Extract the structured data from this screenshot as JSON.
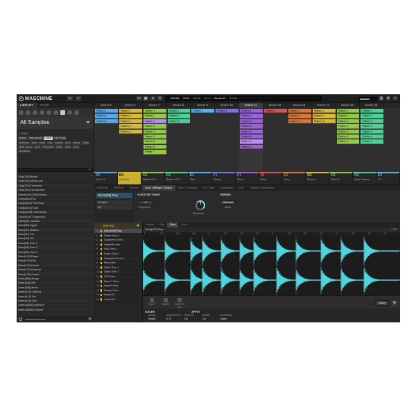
{
  "app": {
    "name": "MASCHINE"
  },
  "titlebar": {
    "tempo": "125.00",
    "tempo_unit": "BPM",
    "swing": "0.0 %",
    "signature": "4 / 4",
    "scene": "Scene 11",
    "position": "1 / 16"
  },
  "browser": {
    "tabs": [
      "LIBRARY",
      "FILES"
    ],
    "category": "All Samples",
    "types_label": "TYPES",
    "type_chips": [
      "Drums",
      "Instruments",
      "Loops",
      "One Shots"
    ],
    "sub_chips": [
      "Ambience",
      "Bass",
      "Brass",
      "Clap",
      "Cymbal",
      "Drum",
      "Drums",
      "Guitar",
      "Hihat Closed",
      "Keys",
      "Percussion",
      "Snare",
      "Synth",
      "Vocal",
      "Woodwind"
    ],
    "files": [
      "Clap[126] Biplan",
      "Clap[128] Melbourne",
      "Clap[129] Teomonie",
      "Clap[130] Youngblown",
      "Openhhnd[126] Entropy",
      "Conga[84] Pux",
      "Conga[110] Feleriosa",
      "Conga[110] Gaia",
      "Conga[128] Chlorophyll",
      "Crash[140] TrappedUp",
      "Dairo[86] Caravan",
      "Dairo[88] Egypt",
      "Dairo[90] Mataco",
      "Dairo[90] Pet",
      "Dairo[96] Rio",
      "Dairo[96] Raw 1",
      "Dairo[96] Raw 2",
      "Dairo[96] Raw 3",
      "Dairo[100] Rajan",
      "Dairo[100] Rak",
      "Dairo[104] Camel",
      "Dairo[110] Kalahari",
      "Dairo[120] Camel",
      "Darbu[86] Mirage",
      "Darbu[90] Nile",
      "Darbu[98] Merrin",
      "Darbu[104] Sahrna",
      "Darbu[110] Rio",
      "Darbu[118] Zen",
      "Darbuka[90] Elephant",
      "Darbuka[95] Folklore"
    ]
  },
  "arranger": {
    "scenes": [
      "Scene 5",
      "Scene 6",
      "Scene 7",
      "Scene 8",
      "Scene 9",
      "Scene 10",
      "Scene 11",
      "Scene 12",
      "Scene 13",
      "Scene 14",
      "Scene 15",
      "Scene 16"
    ],
    "current_scene_index": 6,
    "columns": [
      {
        "color": "#5da7e6",
        "patterns": [
          "Pattern 1",
          "Pattern 4",
          "Pattern 4"
        ]
      },
      {
        "color": "#d6b83c",
        "patterns": [
          "Pattern 1",
          "Pattern 2",
          "Pattern 2",
          "Pattern 3",
          "Pattern 3"
        ]
      },
      {
        "color": "#93c94b",
        "patterns": [
          "Pattern 1",
          "Pattern 2",
          "Pattern 4",
          "Pattern 5",
          "Pattern 2",
          "Pattern 3",
          "Pattern 6",
          "Pattern 8",
          "Pattern 7"
        ]
      },
      {
        "color": "#4fcf96",
        "patterns": [
          "Pattern 1",
          "Pattern 2",
          "Pattern 3"
        ]
      },
      {
        "color": "#58b3e8",
        "patterns": [
          "Pattern 1"
        ]
      },
      {
        "color": "#7c72e3",
        "patterns": [
          "Pattern 1"
        ]
      },
      {
        "color": "#9b63d8",
        "patterns": [
          "Pattern 1",
          "Pattern 2",
          "Pattern 3",
          "Pattern 4",
          "Pattern 5",
          "Pattern 6",
          "Pattern 7",
          "Pattern 8"
        ]
      },
      {
        "color": "#d85454",
        "patterns": [
          "Pattern 1"
        ]
      },
      {
        "color": "#d2793f",
        "patterns": [
          "Pattern 1",
          "Pattern 2",
          "Pattern 3"
        ]
      },
      {
        "color": "#d6b83c",
        "patterns": [
          "Pattern 1",
          "Pattern 2",
          "Pattern 3"
        ]
      },
      {
        "color": "#93c94b",
        "patterns": [
          "Pattern 1",
          "Pattern 2",
          "Pattern 3",
          "Pattern 4",
          "Pattern 5",
          "Pattern 6",
          "Pattern 7"
        ]
      },
      {
        "color": "#4fcf96",
        "patterns": [
          "Pattern 1",
          "Pattern 2",
          "Pattern 3",
          "Pattern 4",
          "Pattern 5",
          "Pattern 6",
          "Pattern 7"
        ]
      }
    ],
    "groups": [
      {
        "id": "A1",
        "name": "Gem Kit",
        "color": "#5da7e6"
      },
      {
        "id": "B1",
        "name": "Gem Kit",
        "color": "#d6b83c"
      },
      {
        "id": "C1",
        "name": "Blatter Kit 2",
        "color": "#93c94b"
      },
      {
        "id": "D1",
        "name": "Blatter Kit 2",
        "color": "#4fcf96"
      },
      {
        "id": "E1",
        "name": "Wire",
        "color": "#58b3e8"
      },
      {
        "id": "F1",
        "name": "Stomp",
        "color": "#7c72e3"
      },
      {
        "id": "G1",
        "name": "Shout",
        "color": "#9b63d8"
      },
      {
        "id": "H1",
        "name": "Blow",
        "color": "#d85454"
      },
      {
        "id": "A2",
        "name": "Gem",
        "color": "#d2793f"
      },
      {
        "id": "B2",
        "name": "Exec 1",
        "color": "#d6b83c"
      },
      {
        "id": "C2",
        "name": "Drum 2",
        "color": "#93c94b"
      },
      {
        "id": "D2",
        "name": "Amb Horizon",
        "color": "#4fcf96"
      },
      {
        "id": "E2",
        "name": "Pr...",
        "color": "#58b3e8"
      }
    ],
    "selected_group_index": 1
  },
  "controls": {
    "tabs": [
      "MASTER",
      "GROUP",
      "SOUND",
      "Voice Settings / Engine",
      "Pitch / Envelope",
      "FX / Filter",
      "Modulation",
      "LFO",
      "Velocity / Modwheel"
    ],
    "active_tab_index": 3,
    "slot": {
      "name": "Dairo[100] Raw",
      "plugin": "Sampler",
      "eq": "EQ"
    },
    "voice_settings_label": "VOICE SETTINGS",
    "polyphony_label": "Polyphony",
    "polyphony_value": "8",
    "pitchbend_label": "Pitchbend",
    "engine_label": "ENGINE",
    "mode_label": "Mode",
    "mode_value": "Standard"
  },
  "pads": {
    "kit_name": "Gem Kit",
    "items": [
      {
        "n": "1",
        "name": "Dairo[100] Raw",
        "color": "#d6b83c"
      },
      {
        "n": "2",
        "name": "Snare Gem 1",
        "color": "#d6b83c"
      },
      {
        "n": "3",
        "name": "ClosedHH Gem 1",
        "color": "#d6b83c"
      },
      {
        "n": "4",
        "name": "OpenHH Gem",
        "color": "#d6b83c"
      },
      {
        "n": "5",
        "name": "Kick Gem 2",
        "color": "#d6b83c"
      },
      {
        "n": "6",
        "name": "Snare Gem 4",
        "color": "#d6b83c"
      },
      {
        "n": "7",
        "name": "ClosedHH Gem 2",
        "color": "#d6b83c"
      },
      {
        "n": "8",
        "name": "Perc Gem",
        "color": "#d6b83c"
      },
      {
        "n": "9",
        "name": "Glitch Gem 1",
        "color": "#d6b83c"
      },
      {
        "n": "10",
        "name": "Glitch Gem 2",
        "color": "#d6b83c"
      },
      {
        "n": "11",
        "name": "SFX Gem",
        "color": "#d6b83c"
      },
      {
        "n": "12",
        "name": "Bass C Gem",
        "color": "#d6b83c"
      },
      {
        "n": "13",
        "name": "Impact Gem",
        "color": "#d6b83c"
      },
      {
        "n": "14",
        "name": "Sweep Gem",
        "color": "#d6b83c"
      },
      {
        "n": "15",
        "name": "Sound 15",
        "color": "#d6b83c"
      },
      {
        "n": "16",
        "name": "Sound 16",
        "color": "#d6b83c"
      }
    ],
    "selected_index": 0
  },
  "editor": {
    "tabs": [
      "Record",
      "Edit",
      "Slice",
      "Zone"
    ],
    "active_tab_index": 2,
    "sample_name": "Dairo[100] Raw",
    "zoom": "4.00x",
    "ruler": [
      "1",
      "1.2",
      "1.3",
      "1.4",
      "2",
      "2.2",
      "2.3",
      "2.4",
      "3",
      "3.2",
      "3.3",
      "3.4",
      "4",
      "4.2",
      "4.3",
      "4.4"
    ],
    "wave_color": "#4fd3dc",
    "tools": [
      "SLICE",
      "SHARE",
      "DELETE ALL"
    ],
    "apply_label": "Apply",
    "slicer": {
      "label": "SLICER",
      "apply_label": "APPLY",
      "params": [
        {
          "label": "MODE",
          "value": "Detect"
        },
        {
          "label": "SENSITIVITY",
          "value": "0.71"
        },
        {
          "label": "ZERO-X",
          "value": "On"
        },
        {
          "label": "MODE",
          "value": "On"
        },
        {
          "label": "PATTERN",
          "value": "None"
        }
      ]
    }
  }
}
